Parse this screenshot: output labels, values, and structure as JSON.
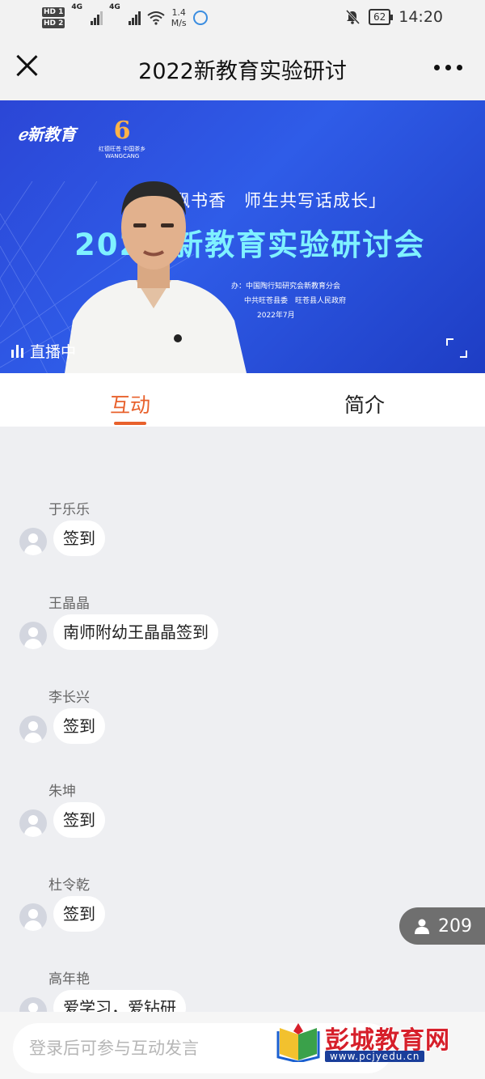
{
  "status_bar": {
    "sim1": "HD 1",
    "sim2": "HD 2",
    "network1": "4G",
    "network2": "4G",
    "speed_value": "1.4",
    "speed_unit": "M/s",
    "battery": "62",
    "time": "14:20"
  },
  "nav": {
    "title": "2022新教育实验研讨"
  },
  "video": {
    "logo_text": "新教育",
    "logo2_text": "红德旺苍 中国茶乡",
    "logo2_sub": "WANGCANG",
    "subtitle": "「　　飘书香　师生共写话成长」",
    "headline": "202　新教育实验研讨会",
    "org_line1": "办：中国陶行知研究会新教育分会",
    "org_line2": "中共旺苍县委　旺苍县人民政府",
    "date": "2022年7月",
    "live_label": "直播中"
  },
  "tabs": [
    {
      "label": "互动",
      "active": true
    },
    {
      "label": "简介",
      "active": false
    }
  ],
  "messages": [
    {
      "name": "",
      "text": "签到"
    },
    {
      "name": "于乐乐",
      "text": "签到"
    },
    {
      "name": "王晶晶",
      "text": "南师附幼王晶晶签到"
    },
    {
      "name": "李长兴",
      "text": "签到"
    },
    {
      "name": "朱坤",
      "text": "签到"
    },
    {
      "name": "杜令乾",
      "text": "签到"
    },
    {
      "name": "高年艳",
      "text": "爱学习，爱钻研"
    }
  ],
  "viewers": {
    "count": "209"
  },
  "input": {
    "placeholder": "登录后可参与互动发言"
  },
  "watermark": {
    "title": "彭城教育网",
    "url": "www.pcjyedu.cn"
  },
  "colors": {
    "accent": "#e8612c",
    "video_bg": "#2f5ce8",
    "headline": "#7ff1ff"
  }
}
